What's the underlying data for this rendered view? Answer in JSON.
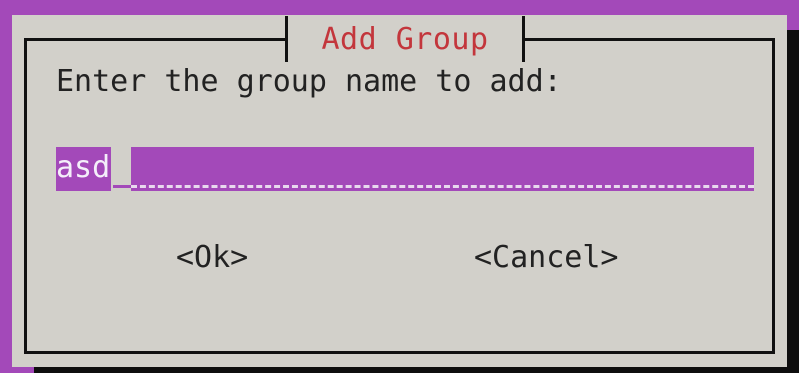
{
  "dialog": {
    "title": "Add Group",
    "prompt": "Enter the group name to add:",
    "input": {
      "value": "asd"
    },
    "buttons": {
      "ok_label": "<Ok>",
      "cancel_label": "<Cancel>"
    }
  },
  "colors": {
    "background": "#a349b9",
    "dialog_bg": "#d2d0ca",
    "title_text": "#c3363c",
    "input_bg": "#a349b9",
    "shadow": "#0e0e0e"
  }
}
